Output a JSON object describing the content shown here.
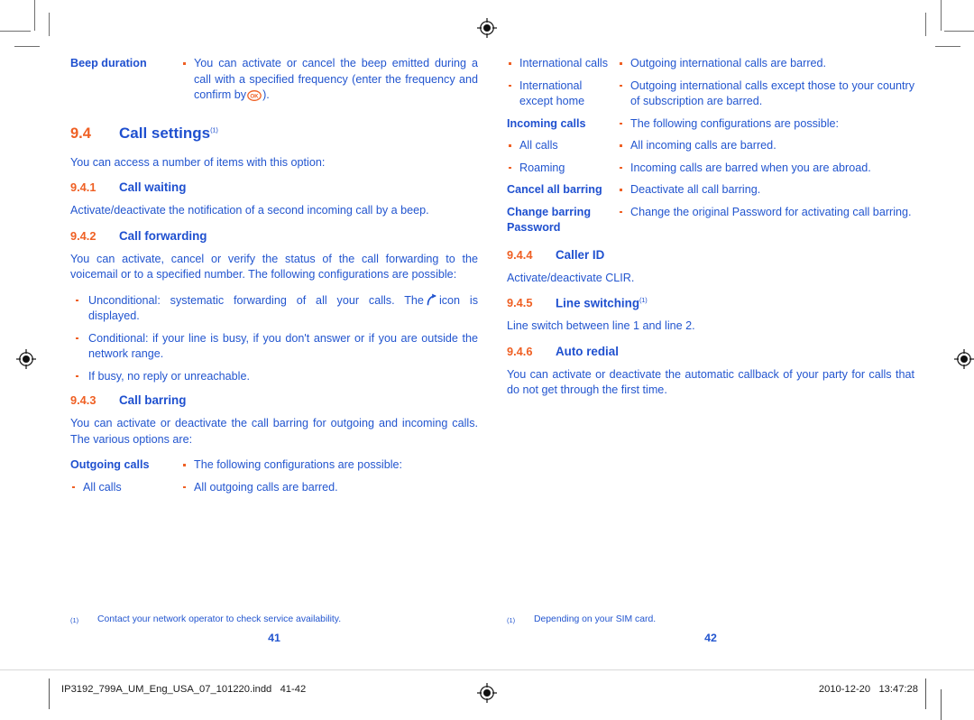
{
  "document": {
    "slug_filename": "IP3192_799A_UM_Eng_USA_07_101220.indd   41-42",
    "slug_date": "2010-12-20   13:47:28"
  },
  "left_page": {
    "folio": "41",
    "beep_duration": {
      "term": "Beep duration",
      "desc_part1": "You can activate or cancel the beep emitted during a call with a specified frequency (enter the frequency and confirm by",
      "desc_part2": ")."
    },
    "section_94": {
      "number": "9.4",
      "title": "Call settings",
      "footnote_mark": "(1)",
      "intro": "You can access a number of items with this option:"
    },
    "section_941": {
      "number": "9.4.1",
      "title": "Call waiting",
      "body": "Activate/deactivate the notification of a second incoming call by a beep."
    },
    "section_942": {
      "number": "9.4.2",
      "title": "Call forwarding",
      "body": "You can activate, cancel or verify the status of the call forwarding to the voicemail or to a specified number. The following configurations are possible:",
      "bullets": [
        {
          "text_before": "Unconditional: systematic forwarding of all your calls. The",
          "text_after": "icon is displayed.",
          "icon": "call-divert-icon"
        },
        {
          "text": "Conditional: if your line is busy, if you don't answer or if you are outside the network range."
        },
        {
          "text": "If busy, no reply or unreachable."
        }
      ]
    },
    "section_943": {
      "number": "9.4.3",
      "title": "Call barring",
      "body": "You can activate or deactivate the call barring for outgoing and incoming calls. The various options are:",
      "rows": [
        {
          "term": "Outgoing calls",
          "term_bold": true,
          "term_bullet": false,
          "desc": "The following configurations are possible:"
        },
        {
          "term": "All calls",
          "term_bold": false,
          "term_bullet": true,
          "desc": "All outgoing calls are barred."
        }
      ]
    },
    "footnote": {
      "mark": "(1)",
      "text": "Contact your network operator to check service availability."
    }
  },
  "right_page": {
    "folio": "42",
    "barring_rows": [
      {
        "term": "International calls",
        "term_bold": false,
        "term_bullet": true,
        "desc": "Outgoing international calls are barred."
      },
      {
        "term": "International except home",
        "term_bold": false,
        "term_bullet": true,
        "desc": "Outgoing international calls except those to your country of subscription are barred."
      },
      {
        "term": "Incoming calls",
        "term_bold": true,
        "term_bullet": false,
        "desc": "The following configurations are possible:"
      },
      {
        "term": "All calls",
        "term_bold": false,
        "term_bullet": true,
        "desc": "All incoming calls are barred."
      },
      {
        "term": "Roaming",
        "term_bold": false,
        "term_bullet": true,
        "desc": "Incoming calls are barred when you are abroad."
      },
      {
        "term": "Cancel all barring",
        "term_bold": true,
        "term_bullet": false,
        "desc": "Deactivate all call barring."
      },
      {
        "term": "Change barring Password",
        "term_bold": true,
        "term_bullet": false,
        "desc": "Change the original Password for activating call barring."
      }
    ],
    "section_944": {
      "number": "9.4.4",
      "title": "Caller ID",
      "body": "Activate/deactivate CLIR."
    },
    "section_945": {
      "number": "9.4.5",
      "title": "Line switching",
      "footnote_mark": "(1)",
      "body": "Line switch between line 1 and line 2."
    },
    "section_946": {
      "number": "9.4.6",
      "title": "Auto redial",
      "body": "You can activate or deactivate the automatic callback of your party for calls that do not get through the first time."
    },
    "footnote": {
      "mark": "(1)",
      "text": "Depending on your SIM card."
    }
  },
  "colors": {
    "heading_blue": "#1f50cf",
    "body_blue": "#2255cf",
    "accent_orange": "#ef6024"
  }
}
